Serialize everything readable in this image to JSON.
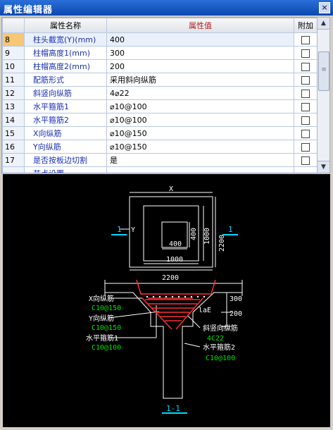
{
  "window": {
    "title": "属性编辑器",
    "close": "×"
  },
  "grid": {
    "headers": {
      "name": "属性名称",
      "value": "属性值",
      "attach": "附加"
    },
    "rows": [
      {
        "num": "8",
        "name": "柱头截宽(Y)(mm)",
        "value": "400"
      },
      {
        "num": "9",
        "name": "柱帽高度1(mm)",
        "value": "300"
      },
      {
        "num": "10",
        "name": "柱帽高度2(mm)",
        "value": "200"
      },
      {
        "num": "11",
        "name": "配筋形式",
        "value": "采用斜向纵筋"
      },
      {
        "num": "12",
        "name": "斜竖向纵筋",
        "value": "4⌀22"
      },
      {
        "num": "13",
        "name": "水平箍筋1",
        "value": "⌀10@100"
      },
      {
        "num": "14",
        "name": "水平箍筋2",
        "value": "⌀10@100"
      },
      {
        "num": "15",
        "name": "X向纵筋",
        "value": "⌀10@150"
      },
      {
        "num": "16",
        "name": "Y向纵筋",
        "value": "⌀10@150"
      },
      {
        "num": "17",
        "name": "是否按板边切割",
        "value": "是"
      },
      {
        "num": "",
        "name": "节点设置",
        "value": ""
      }
    ],
    "scroll": {
      "up": "▲",
      "down": "▼",
      "grip": "≡"
    }
  },
  "drawing": {
    "plan": {
      "x": "X",
      "y": "Y",
      "d2200h": "2200",
      "d2200v": "2200",
      "d1000h": "1000",
      "d1000v": "1000",
      "d400h": "400",
      "d400v": "400",
      "sec_left": "1",
      "sec_right": "1"
    },
    "section": {
      "x_rebar": "X向纵筋",
      "x_rebar_spec": "C10@150",
      "y_rebar": "Y向纵筋",
      "y_rebar_spec": "C10@150",
      "hoop1": "水平箍筋1",
      "hoop1_spec": "C10@100",
      "diag": "斜竖向纵筋",
      "diag_spec": "4C22",
      "hoop2": "水平箍筋2",
      "hoop2_spec": "C10@100",
      "d300": "300",
      "d200": "200",
      "lae": "laE",
      "title": "1-1"
    },
    "colors": {
      "line": "#ffffff",
      "green": "#00e000",
      "red": "#ff3030",
      "cyan": "#00d8ff"
    }
  }
}
